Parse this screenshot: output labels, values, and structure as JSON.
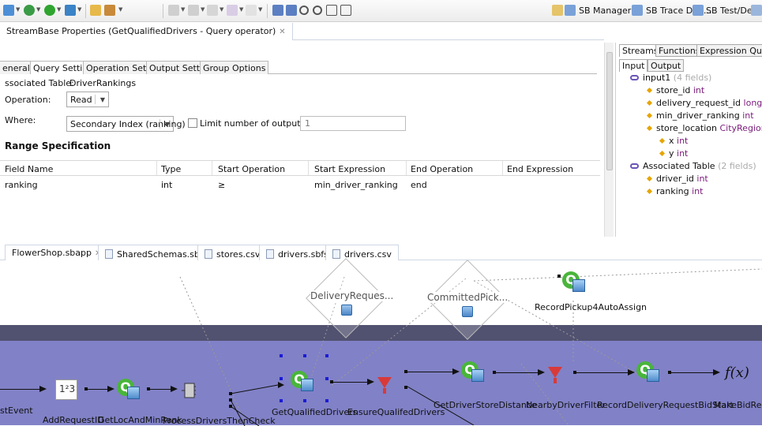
{
  "perspectives": [
    {
      "label": "SB Manager"
    },
    {
      "label": "SB Trace Deb..."
    },
    {
      "label": "SB Test/Debug"
    }
  ],
  "properties": {
    "title": "StreamBase Properties (GetQualifiedDrivers - Query operator)",
    "close_glyph": "✕",
    "tabs": [
      "eneral",
      "Query Settings",
      "Operation Settings",
      "Output Settings",
      "Group Options"
    ],
    "associated_table_label": "ssociated Table:",
    "associated_table_value": "DriverRankings",
    "operation_label": "Operation:",
    "operation_value": "Read",
    "where_label": "Where:",
    "where_value": "Secondary Index (ranking)",
    "limit_label": "Limit number of output rows:",
    "limit_value": "1",
    "range_title": "Range Specification",
    "columns": [
      "Field Name",
      "Type",
      "Start Operation",
      "Start Expression",
      "End Operation",
      "End Expression"
    ],
    "rows": [
      [
        "ranking",
        "int",
        "≥",
        "min_driver_ranking",
        "end",
        ""
      ]
    ]
  },
  "right_panel": {
    "tabs": [
      "Streams",
      "Functions",
      "Expression QuickRef"
    ],
    "subtabs": [
      "Input",
      "Output"
    ],
    "tree": [
      {
        "name": "input1",
        "meta": "(4 fields)",
        "kind": "stream"
      },
      {
        "name": "store_id",
        "type": "int",
        "kind": "field"
      },
      {
        "name": "delivery_request_id",
        "type": "long",
        "kind": "field"
      },
      {
        "name": "min_driver_ranking",
        "type": "int",
        "kind": "field"
      },
      {
        "name": "store_location",
        "type": "CityRegion",
        "kind": "field"
      },
      {
        "name": "x",
        "type": "int",
        "kind": "subfield"
      },
      {
        "name": "y",
        "type": "int",
        "kind": "subfield"
      },
      {
        "name": "Associated Table",
        "meta": "(2 fields)",
        "kind": "stream"
      },
      {
        "name": "driver_id",
        "type": "int",
        "kind": "field"
      },
      {
        "name": "ranking",
        "type": "int",
        "kind": "field"
      }
    ]
  },
  "editor_tabs": [
    {
      "label": "FlowerShop.sbapp",
      "closable": true
    },
    {
      "label": "SharedSchemas.sbapp"
    },
    {
      "label": "stores.csv"
    },
    {
      "label": "drivers.sbfs"
    },
    {
      "label": "drivers.csv"
    }
  ],
  "canvas": {
    "data_stores": [
      "DeliveryReques...",
      "CommittedPick..."
    ],
    "top_node": "RecordPickup4AutoAssign",
    "nodes": [
      "stEvent",
      "AddRequestID",
      "GetLocAndMinRank",
      "ProcessDriversThenCheck",
      "GetQualifiedDrivers",
      "EnsureQualifedDrivers",
      "GetDriverStoreDistance",
      "NearbyDriverFilter",
      "RecordDeliveryRequestBidStart",
      "MakeBidReque"
    ],
    "box_text": "1²3",
    "fx_text": "f(x)",
    "q_glyph": "Q"
  },
  "colors": {
    "band": "#8181c7",
    "band_dark": "#515170",
    "query_green": "#49b53a",
    "filter_red": "#d83a3a",
    "type_purple": "#7a1a7a"
  }
}
